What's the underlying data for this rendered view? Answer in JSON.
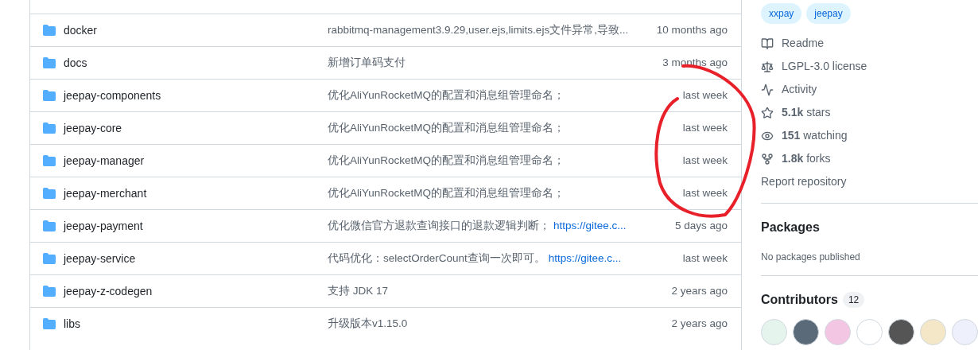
{
  "files": [
    {
      "name": "docker",
      "message": "rabbitmq-management3.9.29,user.ejs,limits.ejs文件异常,导致...",
      "date": "10 months ago"
    },
    {
      "name": "docs",
      "message": "新增订单码支付",
      "date": "3 months ago"
    },
    {
      "name": "jeepay-components",
      "message": "优化AliYunRocketMQ的配置和消息组管理命名；",
      "date": "last week"
    },
    {
      "name": "jeepay-core",
      "message": "优化AliYunRocketMQ的配置和消息组管理命名；",
      "date": "last week"
    },
    {
      "name": "jeepay-manager",
      "message": "优化AliYunRocketMQ的配置和消息组管理命名；",
      "date": "last week"
    },
    {
      "name": "jeepay-merchant",
      "message": "优化AliYunRocketMQ的配置和消息组管理命名；",
      "date": "last week"
    },
    {
      "name": "jeepay-payment",
      "message": "优化微信官方退款查询接口的退款逻辑判断；",
      "link": "https://gitee.c...",
      "date": "5 days ago"
    },
    {
      "name": "jeepay-service",
      "message": "代码优化：selectOrderCount查询一次即可。",
      "link": "https://gitee.c...",
      "date": "last week"
    },
    {
      "name": "jeepay-z-codegen",
      "message": "支持 JDK 17",
      "date": "2 years ago"
    },
    {
      "name": "libs",
      "message": "升级版本v1.15.0",
      "date": "2 years ago"
    }
  ],
  "sidebar": {
    "topics": [
      "xxpay",
      "jeepay"
    ],
    "links": [
      {
        "kind": "readme",
        "label": "Readme"
      },
      {
        "kind": "license",
        "label": "LGPL-3.0 license"
      },
      {
        "kind": "activity",
        "label": "Activity"
      },
      {
        "kind": "stars",
        "label": "stars",
        "count": "5.1k"
      },
      {
        "kind": "watching",
        "label": "watching",
        "count": "151"
      },
      {
        "kind": "forks",
        "label": "forks",
        "count": "1.8k"
      }
    ],
    "report": "Report repository",
    "packages": {
      "title": "Packages",
      "text": "No packages published"
    },
    "contributors": {
      "title": "Contributors",
      "count": "12"
    }
  }
}
